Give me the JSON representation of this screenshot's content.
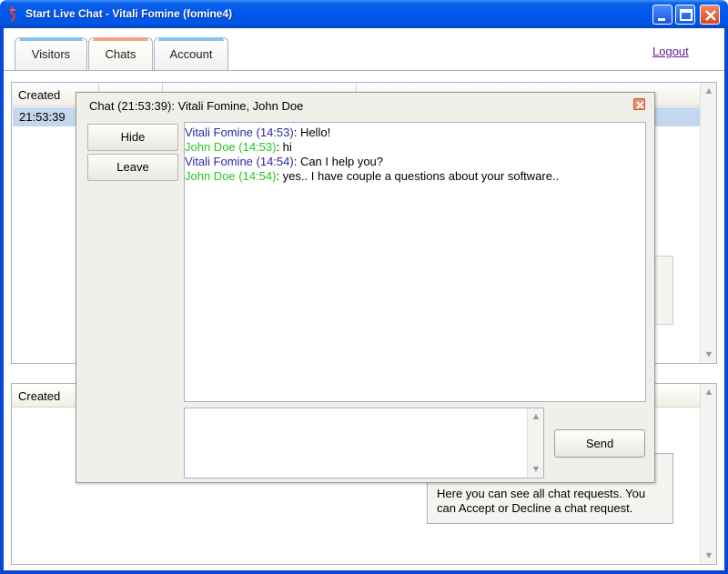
{
  "window": {
    "title": "Start Live Chat - Vitali Fomine (fomine4)"
  },
  "tabs": [
    {
      "label": "Visitors",
      "active": false
    },
    {
      "label": "Chats",
      "active": true
    },
    {
      "label": "Account",
      "active": false
    }
  ],
  "logout_label": "Logout",
  "top_table": {
    "header": "Created",
    "rows": [
      {
        "created": "21:53:39"
      }
    ]
  },
  "bottom_table": {
    "header": "Created"
  },
  "info_text": "Here you can see all chat requests. You can Accept or Decline a chat request.",
  "chat": {
    "title": "Chat (21:53:39): Vitali Fomine, John Doe",
    "hide_label": "Hide",
    "leave_label": "Leave",
    "send_label": "Send",
    "messages": [
      {
        "who": "Vitali Fomine (14:53)",
        "text": ": Hello!",
        "color": "#2a2aa0"
      },
      {
        "who": "John Doe (14:53)",
        "text": ": hi",
        "color": "#22c722"
      },
      {
        "who": "Vitali Fomine (14:54)",
        "text": ": Can I help you?",
        "color": "#2a2aa0"
      },
      {
        "who": "John Doe (14:54)",
        "text": ": yes.. I have couple a questions about your software..",
        "color": "#22c722"
      }
    ]
  }
}
